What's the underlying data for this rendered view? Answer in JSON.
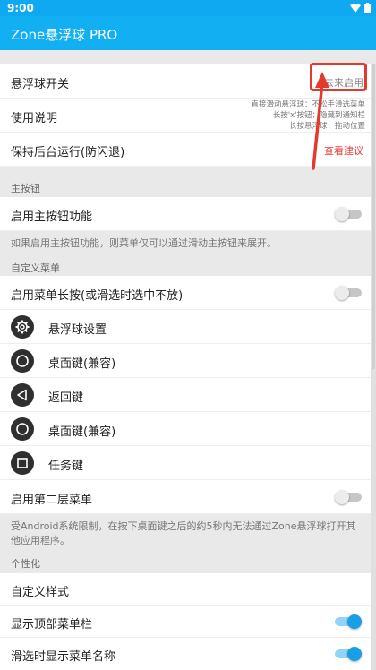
{
  "status_bar": {
    "time": "9:00"
  },
  "app_bar": {
    "title": "Zone悬浮球 PRO"
  },
  "settings": {
    "float_switch": {
      "label": "悬浮球开关",
      "value": "去来启用"
    },
    "instructions": {
      "label": "使用说明",
      "hint_lines": [
        "直接滑动悬浮球：不松手滑选菜单",
        "长按'x'按钮：隐藏到通知栏",
        "长按悬浮球：拖动位置"
      ]
    },
    "keep_alive": {
      "label": "保持后台运行(防闪退)",
      "value": "查看建议"
    }
  },
  "main_button": {
    "section_title": "主按钮",
    "enable_label": "启用主按钮功能",
    "enable_on": false,
    "note": "如果启用主按钮功能，则菜单仅可以通过滑动主按钮来展开。"
  },
  "custom_menu": {
    "section_title": "自定义菜单",
    "long_press_label": "启用菜单长按(或滑选时选中不放)",
    "long_press_on": false,
    "items": [
      {
        "icon": "gear-icon",
        "label": "悬浮球设置"
      },
      {
        "icon": "circle-icon",
        "label": "桌面键(兼容)"
      },
      {
        "icon": "back-triangle-icon",
        "label": "返回键"
      },
      {
        "icon": "circle-icon",
        "label": "桌面键(兼容)"
      },
      {
        "icon": "square-icon",
        "label": "任务键"
      }
    ],
    "second_layer_label": "启用第二层菜单",
    "second_layer_on": false,
    "note": "受Android系统限制，在按下桌面键之后的约5秒内无法通过Zone悬浮球打开其他应用程序。"
  },
  "personalize": {
    "section_title": "个性化",
    "custom_style_label": "自定义样式",
    "show_top_menu_label": "显示顶部菜单栏",
    "show_top_menu_on": true,
    "show_menu_name_label": "滑选时显示菜单名称",
    "show_menu_name_on": true
  },
  "colors": {
    "accent": "#12b0f3",
    "warning": "#e53935",
    "highlight": "#e23b2e"
  }
}
